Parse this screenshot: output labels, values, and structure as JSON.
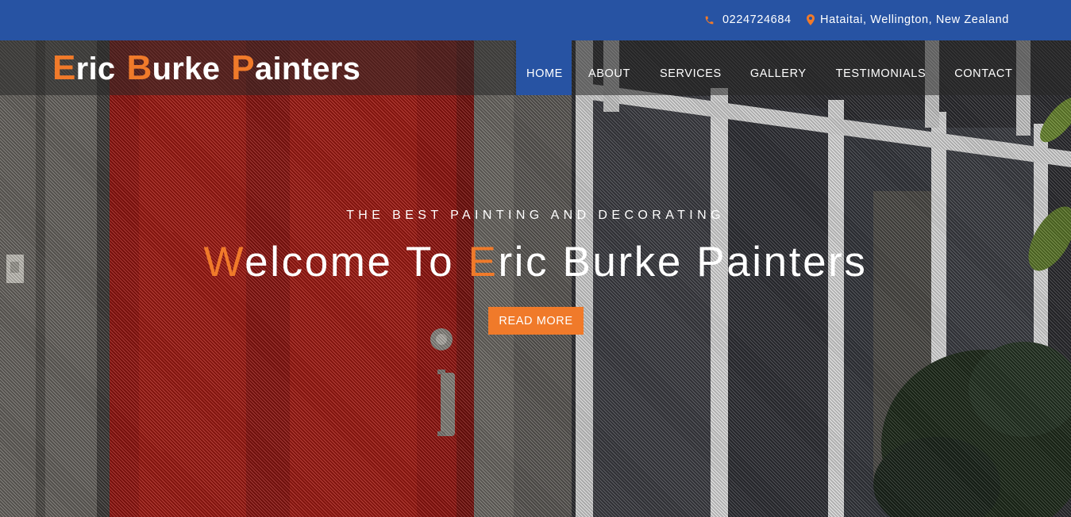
{
  "topbar": {
    "phone": "0224724684",
    "phone_icon": "phone-icon",
    "location": "Hataitai, Wellington, New Zealand",
    "location_icon": "map-marker-icon"
  },
  "logo": {
    "words": [
      {
        "first": "E",
        "rest": "ric"
      },
      {
        "first": "B",
        "rest": "urke"
      },
      {
        "first": "P",
        "rest": "ainters"
      }
    ]
  },
  "nav": {
    "items": [
      "Home",
      "About",
      "Services",
      "Gallery",
      "Testimonials",
      "Contact"
    ],
    "active": "Home"
  },
  "hero": {
    "tagline": "THE BEST PAINTING AND DECORATING",
    "headline": {
      "w_first": "W",
      "w_rest": "elcome To ",
      "e_first": "E",
      "e_rest": "ric Burke Painters"
    },
    "cta_label": "Read More"
  },
  "colors": {
    "brand_blue": "#2753a3",
    "accent_orange": "#f07a2a"
  }
}
